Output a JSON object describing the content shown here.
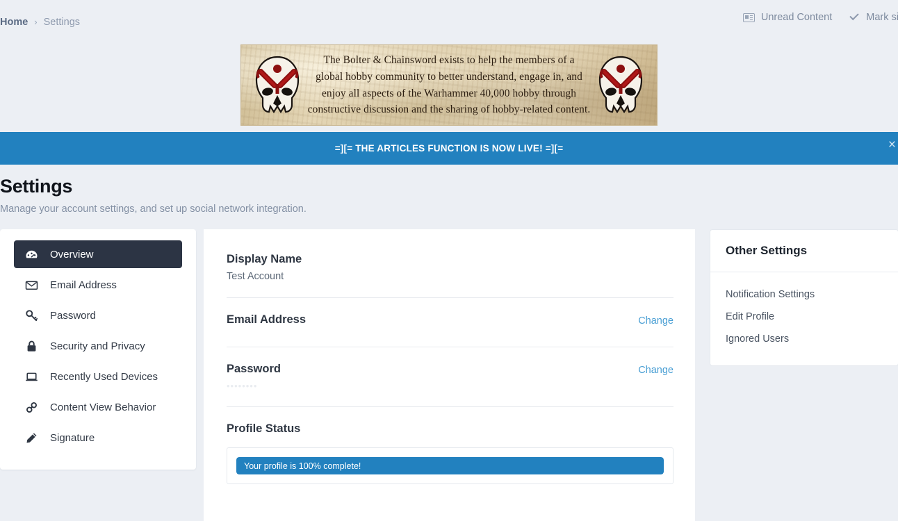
{
  "topbar": {
    "breadcrumb": {
      "home": "Home",
      "separator": "›",
      "current": "Settings"
    },
    "unread_content": "Unread Content",
    "mark_site_read": "Mark site re",
    "news_icon": "news-icon",
    "check_icon": "check-icon"
  },
  "banner": {
    "line1": "The Bolter & Chainsword exists to help the members of a",
    "line2": "global hobby community to better understand, engage in, and",
    "line3": "enjoy all aspects of the Warhammer 40,000 hobby through",
    "line4": "constructive discussion and the sharing of hobby-related content.",
    "left_emblem": "skull-emblem",
    "right_emblem": "skull-emblem"
  },
  "announcement": {
    "text": "=][= THE ARTICLES FUNCTION IS NOW LIVE! =][=",
    "close_label": "×",
    "background_color": "#2281bf"
  },
  "page": {
    "title": "Settings",
    "subtitle": "Manage your account settings, and set up social network integration."
  },
  "sidebar": {
    "items": [
      {
        "label": "Overview",
        "icon": "dashboard-icon",
        "active": true
      },
      {
        "label": "Email Address",
        "icon": "envelope-icon",
        "active": false
      },
      {
        "label": "Password",
        "icon": "key-icon",
        "active": false
      },
      {
        "label": "Security and Privacy",
        "icon": "lock-icon",
        "active": false
      },
      {
        "label": "Recently Used Devices",
        "icon": "laptop-icon",
        "active": false
      },
      {
        "label": "Content View Behavior",
        "icon": "link-icon",
        "active": false
      },
      {
        "label": "Signature",
        "icon": "pencil-icon",
        "active": false
      }
    ]
  },
  "main": {
    "display_name": {
      "title": "Display Name",
      "value": "Test Account"
    },
    "email": {
      "title": "Email Address",
      "value": "",
      "change_label": "Change"
    },
    "password": {
      "title": "Password",
      "value": "••••••••",
      "change_label": "Change"
    },
    "profile_status": {
      "title": "Profile Status",
      "progress_label": "Your profile is 100% complete!",
      "progress_percent": 100,
      "bar_color": "#2281bf"
    }
  },
  "other_settings": {
    "title": "Other Settings",
    "items": [
      {
        "label": "Notification Settings"
      },
      {
        "label": "Edit Profile"
      },
      {
        "label": "Ignored Users"
      }
    ]
  },
  "colors": {
    "page_background": "#eceff4",
    "sidebar_active": "#2c3444",
    "link_blue": "#4a9fd4",
    "accent_blue": "#2281bf"
  }
}
